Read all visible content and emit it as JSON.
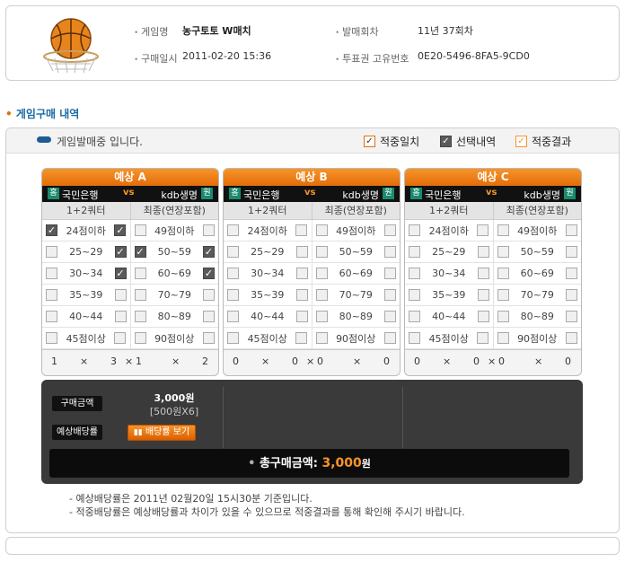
{
  "info": {
    "game_label": "게임명",
    "game_value": "농구토토 W매치",
    "purchase_label": "구매일시",
    "purchase_value": "2011-02-20 15:36",
    "round_label": "발매회차",
    "round_value": "11년 37회차",
    "ticket_label": "투표권 고유번호",
    "ticket_value": "0E20-5496-8FA5-9CD0"
  },
  "section_title": "게임구매 내역",
  "status_text": "게임발매중 입니다.",
  "legend": {
    "hit": "적중일치",
    "selected": "선택내역",
    "result": "적중결과",
    "hit_color": "#e46d0a",
    "selected_color": "#5a5a5a",
    "result_color": "#f7942a"
  },
  "panels": [
    {
      "title": "예상 A",
      "home_tag": "홈",
      "home": "국민은행",
      "vs": "vs",
      "away": "kdb생명",
      "away_tag": "원",
      "col1": "1+2쿼터",
      "col2": "최종(연장포함)",
      "left_labels": [
        "24점이하",
        "25~29",
        "30~34",
        "35~39",
        "40~44",
        "45점이상"
      ],
      "right_labels": [
        "49점이하",
        "50~59",
        "60~69",
        "70~79",
        "80~89",
        "90점이상"
      ],
      "checks": [
        [
          true,
          true,
          false,
          false
        ],
        [
          false,
          true,
          true,
          true
        ],
        [
          false,
          true,
          false,
          true
        ],
        [
          false,
          false,
          false,
          false
        ],
        [
          false,
          false,
          false,
          false
        ],
        [
          false,
          false,
          false,
          false
        ]
      ],
      "score": [
        "1",
        "×",
        "3",
        "×",
        "1",
        "×",
        "2"
      ]
    },
    {
      "title": "예상 B",
      "home_tag": "홈",
      "home": "국민은행",
      "vs": "vs",
      "away": "kdb생명",
      "away_tag": "원",
      "col1": "1+2쿼터",
      "col2": "최종(연장포함)",
      "left_labels": [
        "24점이하",
        "25~29",
        "30~34",
        "35~39",
        "40~44",
        "45점이상"
      ],
      "right_labels": [
        "49점이하",
        "50~59",
        "60~69",
        "70~79",
        "80~89",
        "90점이상"
      ],
      "checks": [
        [
          false,
          false,
          false,
          false
        ],
        [
          false,
          false,
          false,
          false
        ],
        [
          false,
          false,
          false,
          false
        ],
        [
          false,
          false,
          false,
          false
        ],
        [
          false,
          false,
          false,
          false
        ],
        [
          false,
          false,
          false,
          false
        ]
      ],
      "score": [
        "0",
        "×",
        "0",
        "×",
        "0",
        "×",
        "0"
      ]
    },
    {
      "title": "예상 C",
      "home_tag": "홈",
      "home": "국민은행",
      "vs": "vs",
      "away": "kdb생명",
      "away_tag": "원",
      "col1": "1+2쿼터",
      "col2": "최종(연장포함)",
      "left_labels": [
        "24점이하",
        "25~29",
        "30~34",
        "35~39",
        "40~44",
        "45점이상"
      ],
      "right_labels": [
        "49점이하",
        "50~59",
        "60~69",
        "70~79",
        "80~89",
        "90점이상"
      ],
      "checks": [
        [
          false,
          false,
          false,
          false
        ],
        [
          false,
          false,
          false,
          false
        ],
        [
          false,
          false,
          false,
          false
        ],
        [
          false,
          false,
          false,
          false
        ],
        [
          false,
          false,
          false,
          false
        ],
        [
          false,
          false,
          false,
          false
        ]
      ],
      "score": [
        "0",
        "×",
        "0",
        "×",
        "0",
        "×",
        "0"
      ]
    }
  ],
  "summary": {
    "purchase_amount_label": "구매금액",
    "purchase_amount": "3,000원",
    "purchase_amount_detail": "[500원X6]",
    "expected_odds_label": "예상배당률",
    "odds_button": "배당률 보기",
    "total_label": "총구매금액:",
    "total_amount": "3,000",
    "total_unit": "원"
  },
  "notes": [
    "- 예상배당률은 2011년 02월20일 15시30분 기준입니다.",
    "- 적중배당률은 예상배당률과 차이가 있을 수 있으므로 적중결과를 통해 확인해 주시기 바랍니다."
  ]
}
